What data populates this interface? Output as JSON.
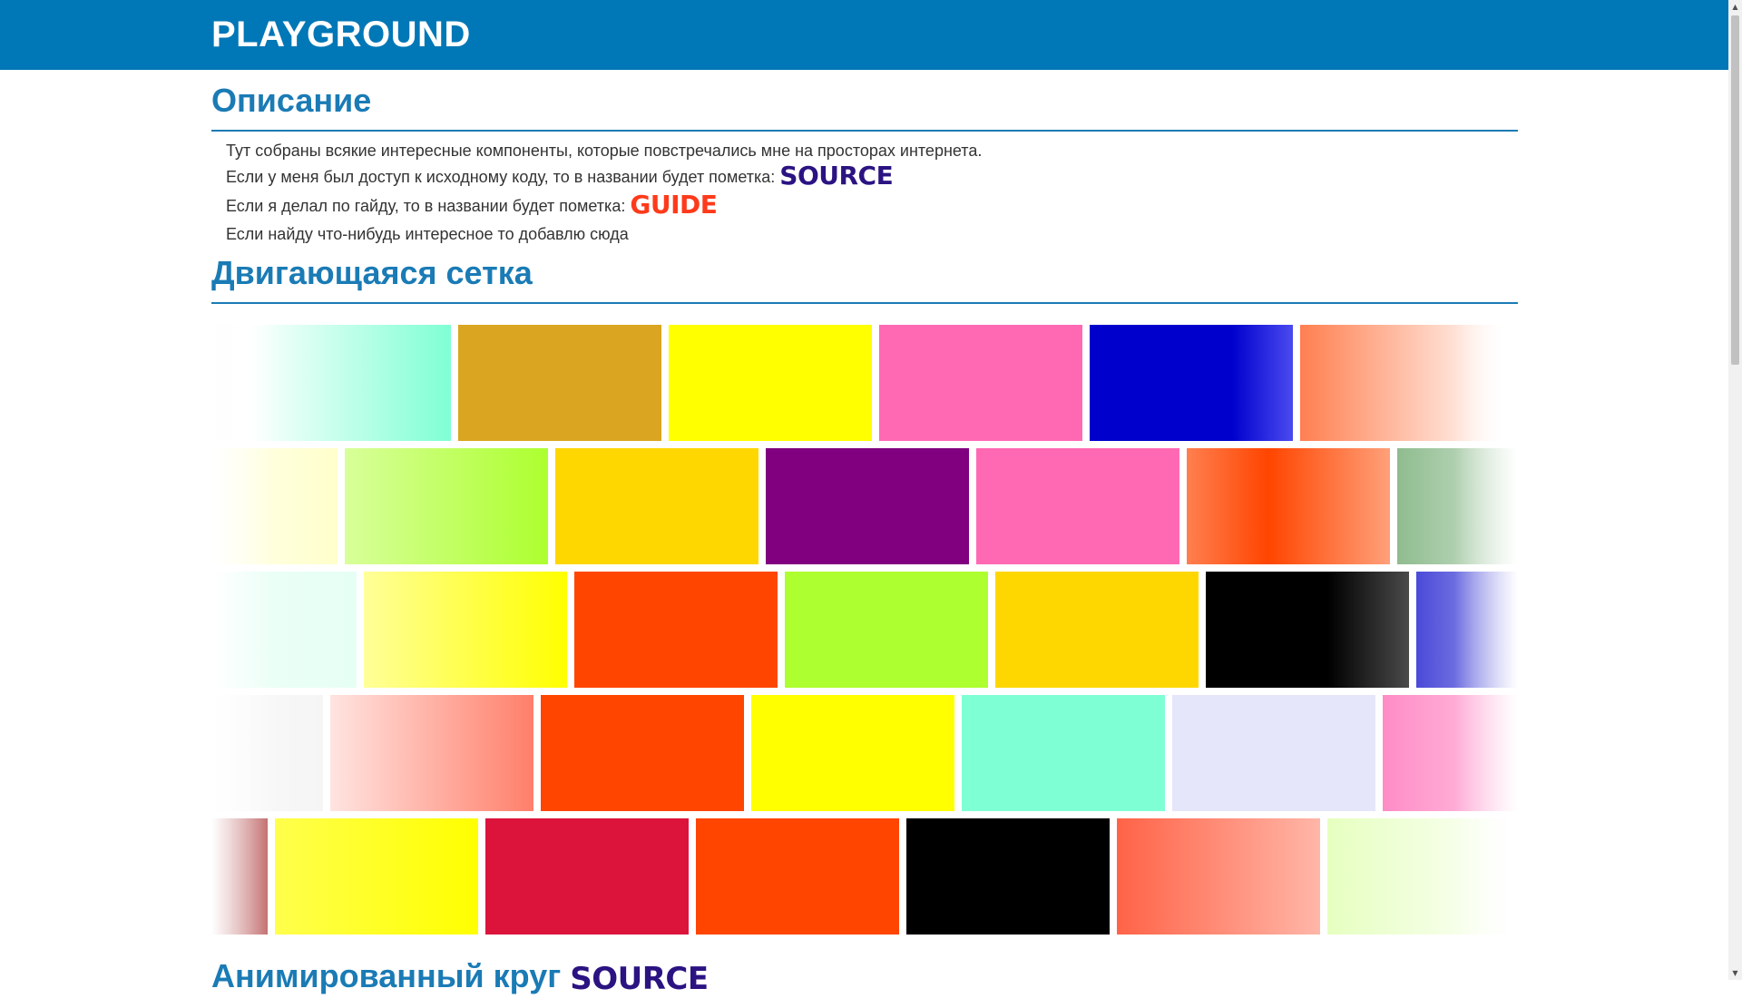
{
  "header": {
    "brand": "PLAYGROUND"
  },
  "description": {
    "title": "Описание",
    "lines": [
      "Тут собраны всякие интересные компоненты, которые повстречались мне на просторах интернета.",
      "Если у меня был доступ к исходному коду, то в названии будет пометка:",
      "Если я делал по гайду, то в названии будет пометка:",
      "Если найду что-нибудь интересное то добавлю сюда"
    ],
    "source_mark": "SOURCE",
    "guide_mark": "GUIDE"
  },
  "moving_grid": {
    "title": "Двигающаяся сетка",
    "rows": [
      {
        "tiles": [
          "linear-gradient(to right, #ffd6d6, #ffffff)",
          "linear-gradient(to right, #ffffff, #7fffd4)",
          "#daa520",
          "#ffff00",
          "#ff69b4",
          "linear-gradient(to right, #0000cd 70%, #4a4af0)",
          "linear-gradient(to right, #ff7f50, #ffffff)"
        ]
      },
      {
        "tiles": [
          "linear-gradient(to right, #ffffff, #ffffcc)",
          "linear-gradient(to right, #d8ff9a, #adff2f)",
          "#ffd700",
          "#800080",
          "#ff69b4",
          "linear-gradient(to right, #ff7f50, #ff4500 40%, #ffa07a)",
          "linear-gradient(to right, #8fbc8f, #ffffff)"
        ]
      },
      {
        "tiles": [
          "linear-gradient(to right, #f0fff8, #e6fff5)",
          "linear-gradient(to right, #ffff99, #ffff00)",
          "#ff4500",
          "#adff2f",
          "#ffd700",
          "linear-gradient(to right, #000000 60%, #4a4a4a)",
          "linear-gradient(to right, #4a4ad9, #ffffff)"
        ]
      },
      {
        "tiles": [
          "linear-gradient(to right, #ffffff, #f5f5f5)",
          "linear-gradient(to right, #ffe4e1, #ff7f6a)",
          "#ff4500",
          "#ffff00",
          "#7fffd4",
          "#e6e6fa",
          "linear-gradient(to right, #ff8cc6, #ffe4f2)",
          "#f5f5f5"
        ]
      },
      {
        "tiles": [
          "linear-gradient(to right, #ffffff, #bc6060)",
          "linear-gradient(to right, #ffff4d, #ffff00)",
          "#dc143c",
          "#ff4500",
          "#000000",
          "linear-gradient(to right, #ff6347, #ffb6a8)",
          "linear-gradient(to right, #e6ffc0, #ffffff)"
        ]
      }
    ]
  },
  "next_section": {
    "title": "Анимированный круг",
    "source_mark": "SOURCE"
  }
}
